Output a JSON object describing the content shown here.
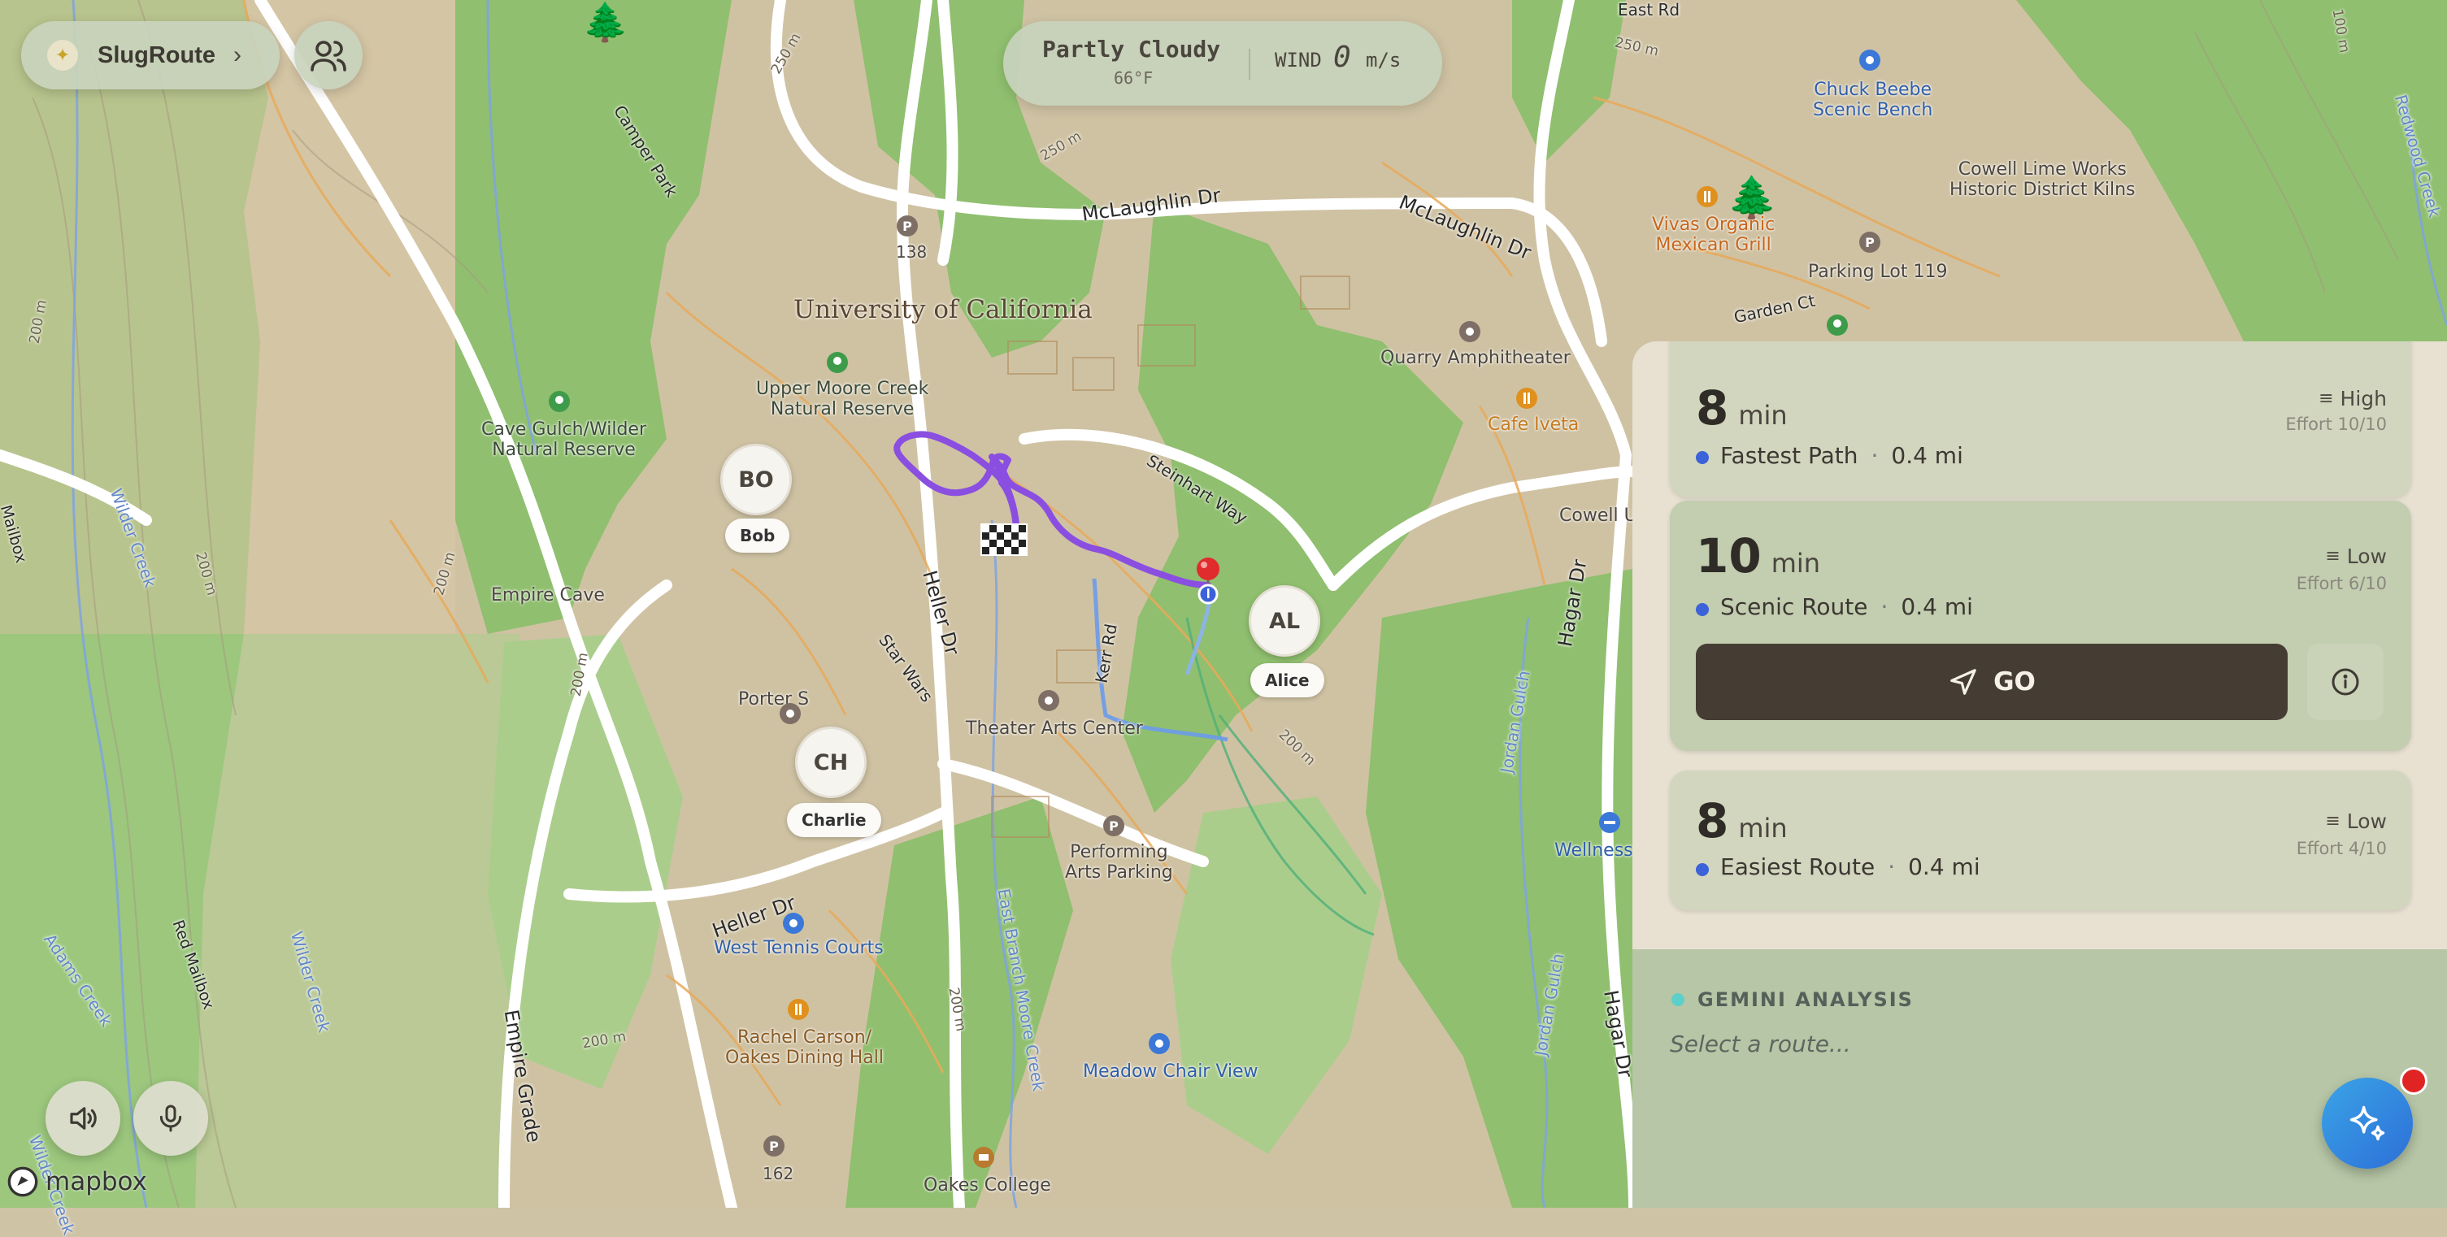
{
  "app": {
    "name": "SlugRoute"
  },
  "weather": {
    "condition": "Partly Cloudy",
    "temperature": "66°F",
    "wind_label": "WIND",
    "wind_value": "0",
    "wind_unit": "m/s"
  },
  "map": {
    "labels": {
      "university": "University of California",
      "upper_moore_1": "Upper Moore Creek",
      "upper_moore_2": "Natural Reserve",
      "cave_gulch_1": "Cave Gulch/Wilder",
      "cave_gulch_2": "Natural Reserve",
      "empire_cave": "Empire Cave",
      "theater": "Theater Arts Center",
      "performing_1": "Performing",
      "performing_2": "Arts Parking",
      "west_tennis": "West Tennis Courts",
      "rachel_1": "Rachel Carson/",
      "rachel_2": "Oakes Dining Hall",
      "meadow": "Meadow Chair View",
      "oakes": "Oakes College",
      "quarry": "Quarry Amphitheater",
      "cafe": "Cafe Iveta",
      "cowell": "Cowell U",
      "wellness": "Wellness",
      "vivas_1": "Vivas Organic",
      "vivas_2": "Mexican Grill",
      "parking119": "Parking Lot 119",
      "chuck_1": "Chuck Beebe",
      "chuck_2": "Scenic Bench",
      "cowell_lime_1": "Cowell Lime Works",
      "cowell_lime_2": "Historic District Kilns",
      "porter": "Porter S",
      "lot138": "138",
      "lot162": "162"
    },
    "roads": {
      "mclaughlin_1": "McLaughlin Dr",
      "mclaughlin_2": "McLaughlin Dr",
      "heller_1": "Heller Dr",
      "heller_2": "Heller Dr",
      "steinhart": "Steinhart Way",
      "hagar_1": "Hagar Dr",
      "hagar_2": "Hagar Dr",
      "empire_grade": "Empire Grade",
      "star_wars": "Star Wars",
      "kerr": "Kerr Rd",
      "camper_park": "Camper Park",
      "garden_ct": "Garden Ct",
      "east_rd": "East Rd",
      "jordan_1": "Jordan Gulch",
      "jordan_2": "Jordan Gulch",
      "east_branch": "East Branch Moore Creek",
      "wilder_1": "Wilder Creek",
      "wilder_2": "Wilder Creek",
      "wilder_3": "Wilder Creek",
      "adams": "Adams Creek",
      "red_mailbox": "Red Mailbox",
      "mailbox": "Mailbox",
      "redwood": "Redwood Creek"
    },
    "contours": {
      "c1": "200 m",
      "c2": "200 m",
      "c3": "200 m",
      "c4": "200 m",
      "c5": "200 m",
      "c6": "200 m",
      "c7": "200 m",
      "c8": "250 m",
      "c9": "250 m",
      "c10": "250 m",
      "c11": "100 m"
    },
    "attribution": "mapbox"
  },
  "friends": [
    {
      "initials": "BO",
      "name": "Bob"
    },
    {
      "initials": "AL",
      "name": "Alice"
    },
    {
      "initials": "CH",
      "name": "Charlie"
    }
  ],
  "routes": [
    {
      "minutes": "8",
      "unit": "min",
      "name": "Fastest Path",
      "distance": "0.4 mi",
      "level": "High",
      "effort": "Effort 10/10"
    },
    {
      "minutes": "10",
      "unit": "min",
      "name": "Scenic Route",
      "distance": "0.4 mi",
      "level": "Low",
      "effort": "Effort 6/10"
    },
    {
      "minutes": "8",
      "unit": "min",
      "name": "Easiest Route",
      "distance": "0.4 mi",
      "level": "Low",
      "effort": "Effort 4/10"
    }
  ],
  "go_label": "GO",
  "analysis": {
    "title": "GEMINI ANALYSIS",
    "body": "Select a route..."
  },
  "colors": {
    "route": "#8a4fe0",
    "go_button": "#453d33",
    "accent": "#3b62d8",
    "gemini": "#2d6fd8"
  },
  "icons": {
    "people": "people-icon",
    "sound": "speaker-icon",
    "mic": "microphone-icon",
    "info": "info-icon",
    "navigate": "navigation-arrow-icon",
    "gemini": "sparkle-icon"
  }
}
